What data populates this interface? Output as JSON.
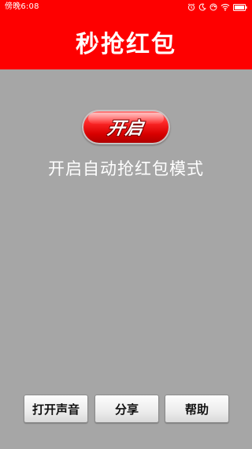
{
  "status_bar": {
    "time": "傍晚6:08",
    "icons": [
      "alarm-icon",
      "moon-icon",
      "sync-icon",
      "wifi-icon",
      "battery-icon"
    ],
    "background": "#fe0000"
  },
  "header": {
    "title": "秒抢红包",
    "background": "#fe0000"
  },
  "main": {
    "toggle_label": "开启",
    "mode_text": "开启自动抢红包模式",
    "background": "#a6a6a6"
  },
  "actions": {
    "sound_label": "打开声音",
    "share_label": "分享",
    "help_label": "帮助"
  }
}
